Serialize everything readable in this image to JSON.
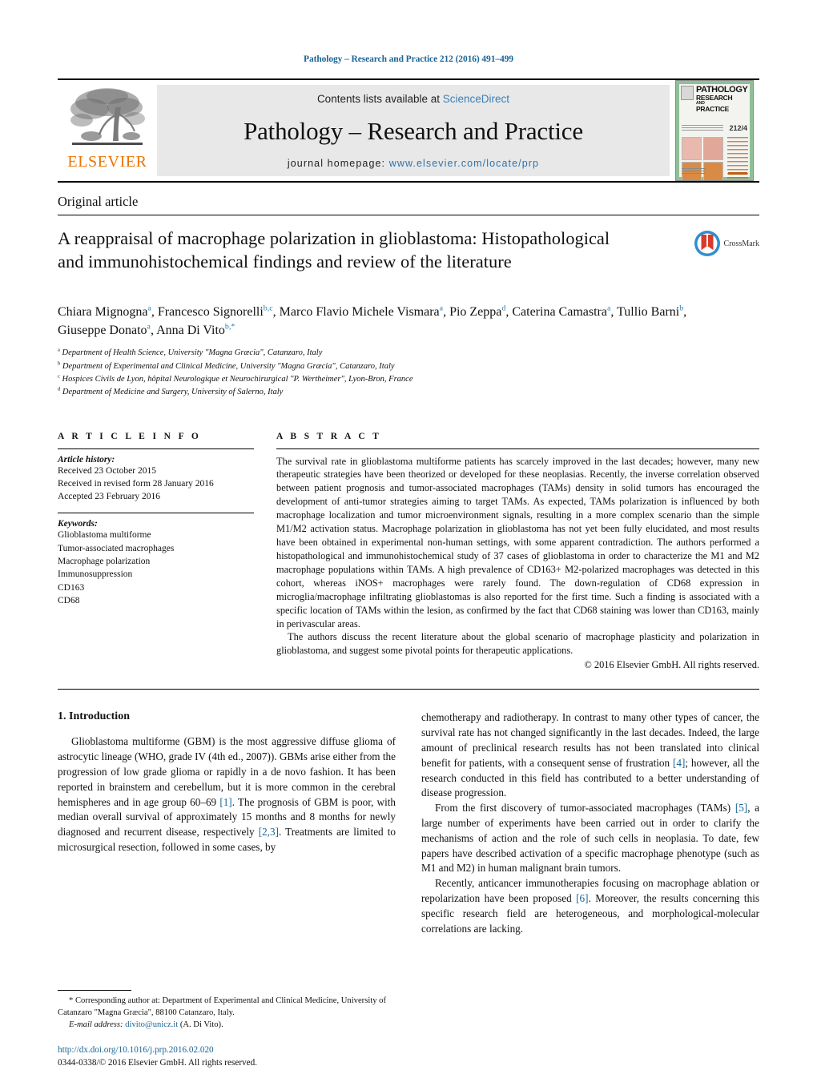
{
  "running_head": "Pathology – Research and Practice 212 (2016) 491–499",
  "masthead": {
    "publisher_logo_text": "ELSEVIER",
    "contents_prefix": "Contents lists available at ",
    "contents_link": "ScienceDirect",
    "journal_title": "Pathology – Research and Practice",
    "homepage_prefix": "journal  homepage:  ",
    "homepage_url": "www.elsevier.com/locate/prp",
    "cover": {
      "line1": "PATHOLOGY",
      "line2": "RESEARCH",
      "line3": "AND",
      "line4": "PRACTICE",
      "issue": "212/4"
    }
  },
  "article_type": "Original article",
  "title": "A reappraisal of macrophage polarization in glioblastoma: Histopathological and immunohistochemical findings and review of the literature",
  "crossmark_label": "CrossMark",
  "authors": [
    {
      "name": "Chiara Mignogna",
      "sup": "a",
      "sep": ", "
    },
    {
      "name": "Francesco Signorelli",
      "sup": "b,c",
      "sep": ", "
    },
    {
      "name": "Marco Flavio Michele Vismara",
      "sup": "a",
      "sep": ", "
    },
    {
      "name": "Pio Zeppa",
      "sup": "d",
      "sep": ", "
    },
    {
      "name": "Caterina Camastra",
      "sup": "a",
      "sep": ", "
    },
    {
      "name": "Tullio Barni",
      "sup": "b",
      "sep": ", "
    },
    {
      "name": "Giuseppe Donato",
      "sup": "a",
      "sep": ", "
    },
    {
      "name": "Anna Di Vito",
      "sup": "b,*",
      "sep": ""
    }
  ],
  "affiliations": [
    {
      "mark": "a",
      "text": "Department of Health Science, University \"Magna Græcia\", Catanzaro, Italy"
    },
    {
      "mark": "b",
      "text": "Department of Experimental and Clinical Medicine, University \"Magna Græcia\", Catanzaro, Italy"
    },
    {
      "mark": "c",
      "text": "Hospices Civils de Lyon, hôpital Neurologique et Neurochirurgical \"P. Wertheimer\", Lyon-Bron, France"
    },
    {
      "mark": "d",
      "text": "Department of Medicine and Surgery, University of Salerno, Italy"
    }
  ],
  "article_info": {
    "heading": "A R T I C L E   I N F O",
    "history_label": "Article history:",
    "history": [
      "Received 23 October 2015",
      "Received in revised form 28 January 2016",
      "Accepted 23 February 2016"
    ],
    "keywords_label": "Keywords:",
    "keywords": [
      "Glioblastoma multiforme",
      "Tumor-associated macrophages",
      "Macrophage polarization",
      "Immunosuppression",
      "CD163",
      "CD68"
    ]
  },
  "abstract": {
    "heading": "A B S T R A C T",
    "paragraph1": "The survival rate in glioblastoma multiforme patients has scarcely improved in the last decades; however, many new therapeutic strategies have been theorized or developed for these neoplasias. Recently, the inverse correlation observed between patient prognosis and tumor-associated macrophages (TAMs) density in solid tumors has encouraged the development of anti-tumor strategies aiming to target TAMs. As expected, TAMs polarization is influenced by both macrophage localization and tumor microenvironment signals, resulting in a more complex scenario than the simple M1/M2 activation status. Macrophage polarization in glioblastoma has not yet been fully elucidated, and most results have been obtained in experimental non-human settings, with some apparent contradiction. The authors performed a histopathological and immunohistochemical study of 37 cases of glioblastoma in order to characterize the M1 and M2 macrophage populations within TAMs. A high prevalence of CD163+ M2-polarized macrophages was detected in this cohort, whereas iNOS+ macrophages were rarely found. The down-regulation of CD68 expression in microglia/macrophage infiltrating glioblastomas is also reported for the first time. Such a finding is associated with a specific location of TAMs within the lesion, as confirmed by the fact that CD68 staining was lower than CD163, mainly in perivascular areas.",
    "paragraph2": "The authors discuss the recent literature about the global scenario of macrophage plasticity and polarization in glioblastoma, and suggest some pivotal points for therapeutic applications.",
    "copyright": "© 2016 Elsevier GmbH. All rights reserved."
  },
  "introduction": {
    "number_title": "1.  Introduction",
    "p1_a": "Glioblastoma multiforme (GBM) is the most aggressive diffuse glioma of astrocytic lineage (WHO, grade IV (4th ed., 2007)). GBMs arise either from the progression of low grade glioma or rapidly in a de novo fashion. It has been reported in brainstem and cerebellum, but it is more common in the cerebral hemispheres and in age group 60–69 ",
    "ref1": "[1]",
    "p1_b": ". The prognosis of GBM is poor, with median overall survival of approximately 15 months and 8 months for newly diagnosed and recurrent disease, respectively ",
    "ref23": "[2,3]",
    "p1_c": ". Treatments are limited to microsurgical resection, followed in some cases, by",
    "p2_a": "chemotherapy and radiotherapy. In contrast to many other types of cancer, the survival rate has not changed significantly in the last decades. Indeed, the large amount of preclinical research results has not been translated into clinical benefit for patients, with a consequent sense of frustration ",
    "ref4": "[4]",
    "p2_b": "; however, all the research conducted in this field has contributed to a better understanding of disease progression.",
    "p3_a": "From the first discovery of tumor-associated macrophages (TAMs) ",
    "ref5": "[5]",
    "p3_b": ", a large number of experiments have been carried out in order to clarify the mechanisms of action and the role of such cells in neoplasia. To date, few papers have described activation of a specific macrophage phenotype (such as M1 and M2) in human malignant brain tumors.",
    "p4_a": "Recently, anticancer immunotherapies focusing on macrophage ablation or repolarization have been proposed ",
    "ref6": "[6]",
    "p4_b": ". Moreover, the results concerning this specific research field are heterogeneous, and morphological-molecular correlations are lacking."
  },
  "footnote": {
    "star": "*",
    "corresponding_a": " Corresponding author at: Department of Experimental and Clinical Medicine, University of Catanzaro \"Magna Græcia\", 88100 Catanzaro, Italy.",
    "email_label": "E-mail address:",
    "email": "divito@unicz.it",
    "email_attrib": " (A. Di Vito).",
    "doi": "http://dx.doi.org/10.1016/j.prp.2016.02.020",
    "issn": "0344-0338/© 2016 Elsevier GmbH. All rights reserved."
  },
  "colors": {
    "link": "#1a6496",
    "elsevier_orange": "#ec7404",
    "cover_green": "#8fbf97"
  }
}
